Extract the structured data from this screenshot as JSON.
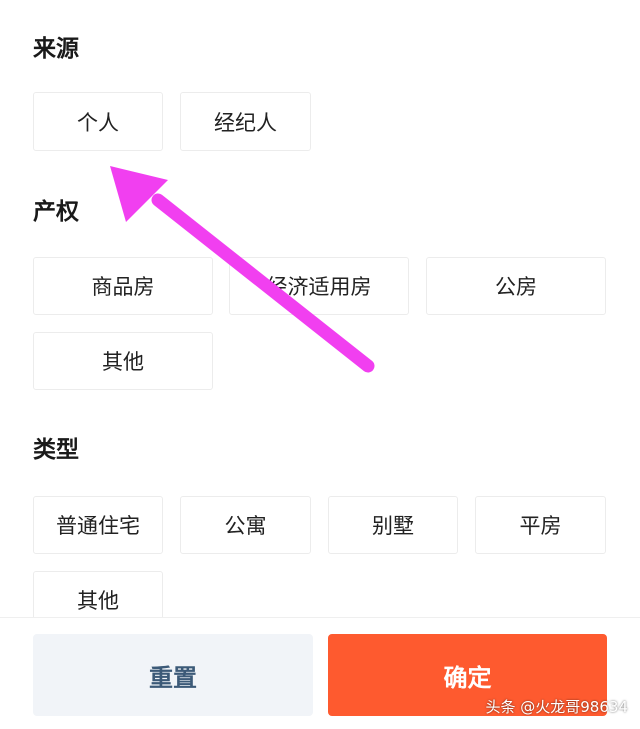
{
  "sections": {
    "source": {
      "title": "来源",
      "options": [
        "个人",
        "经纪人"
      ]
    },
    "property_right": {
      "title": "产权",
      "options": [
        "商品房",
        "经济适用房",
        "公房",
        "其他"
      ]
    },
    "type": {
      "title": "类型",
      "options": [
        "普通住宅",
        "公寓",
        "别墅",
        "平房",
        "其他"
      ]
    }
  },
  "footer": {
    "reset_label": "重置",
    "confirm_label": "确定"
  },
  "watermark": "头条 @火龙哥98634",
  "colors": {
    "confirm": "#fe5a2f",
    "reset_bg": "#f1f4f8",
    "reset_text": "#3c5a78",
    "annotation_arrow": "#f13ff0"
  }
}
